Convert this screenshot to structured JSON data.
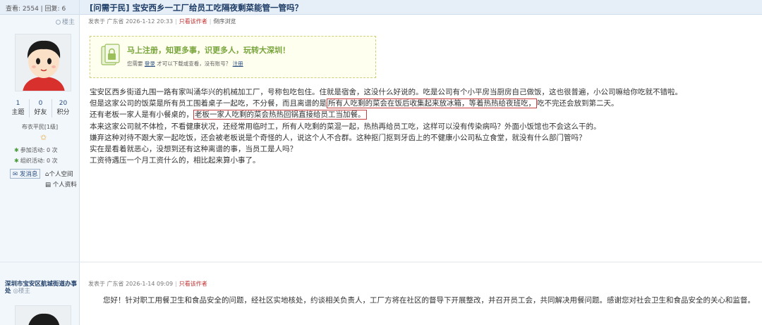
{
  "sidebar": {
    "stats_text": "查看: 2554 | 回复: 6",
    "lz_label": "楼主",
    "counts": [
      {
        "num": "1",
        "label": "主题"
      },
      {
        "num": "0",
        "label": "好友"
      },
      {
        "num": "20",
        "label": "积分"
      }
    ],
    "rank": "布衣平民[1级]",
    "activity1": "参加活动: 0 次",
    "activity2": "组织活动: 0 次",
    "send_msg": "发消息",
    "space": "个人空间",
    "profile": "个人资料"
  },
  "thread": {
    "title": "[问需于民] 宝安西乡一工厂给员工吃隔夜剩菜能管一管吗？",
    "post1_meta": {
      "posted": "发表于 广东省 2026-1-12 20:33",
      "only_author": "只看该作者",
      "reverse": "倒序浏览"
    },
    "notice": {
      "headline": "马上注册，知更多事，识更多人，玩转大深圳！",
      "sub_before": "您需要",
      "login": "登录",
      "sub_middle": "才可以下载或查看，没有账号？",
      "register": "注册"
    },
    "body": [
      "宝安区西乡街道九围一路有家叫涌华兴的机械加工厂，号称包吃包住。住就是宿舍，这没什么好说的。吃是公司有个小平房当厨房自己做饭，这也很普遍，小公司嘛给你吃就不错啦。",
      {
        "before": "但是这家公司的饭菜是所有员工围着桌子一起吃，不分餐，而且离谱的是",
        "mark": "所有人吃剩的菜会在饭后收集起来放冰箱，等着热热给夜班吃，",
        "after": "吃不完还会放到第二天。"
      },
      {
        "before": "还有老板一家人是有小餐桌的，",
        "mark": "老板一家人吃剩的菜会热热回锅直接给员工当加餐。",
        "after": ""
      },
      "本来这家公司就不体检，不看健康状况，还经常用临时工，所有人吃剩的菜混一起，热热再给员工吃，这样可以没有传染病吗？外面小饭馆也不会这么干的。",
      "嫌弃这种对待不跟大家一起吃饭，还会被老板说是个奇怪的人，说这个人不合群。这种抠门抠到牙齿上的不健康小公司私立食堂，就没有什么部门管吗？",
      "实在是看着就恶心，没想到还有这种离谱的事，当员工是人吗？",
      "工资待遇压一个月工资什么的，相比起来算小事了。"
    ]
  },
  "reply": {
    "poster": "深圳市宝安区航城街道办事处",
    "lz_label": "楼主",
    "meta": {
      "posted": "发表于 广东省 2026-1-14 09:09",
      "only_author": "只看该作者"
    },
    "text": "您好！针对职工用餐卫生和食品安全的问题，经社区实地核处，约谈相关负责人，工厂方将在社区的督导下开展整改，并召开员工会，共同解决用餐问题。感谢您对社会卫生和食品安全的关心和监督。"
  }
}
